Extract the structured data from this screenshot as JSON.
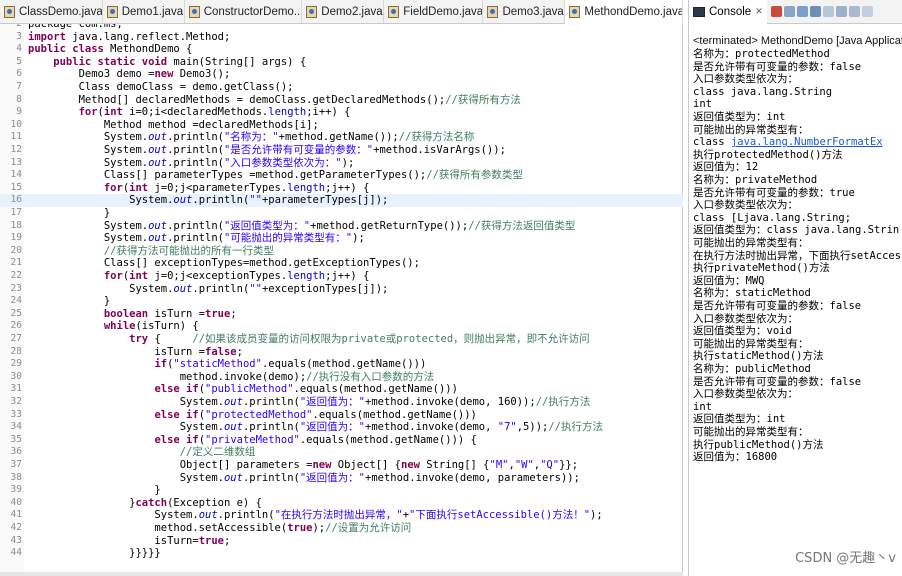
{
  "editor": {
    "tabs": [
      {
        "label": "ClassDemo.java",
        "active": false
      },
      {
        "label": "Demo1.java",
        "active": false
      },
      {
        "label": "ConstructorDemo...",
        "active": false
      },
      {
        "label": "Demo2.java",
        "active": false
      },
      {
        "label": "FieldDemo.java",
        "active": false
      },
      {
        "label": "Demo3.java",
        "active": false
      },
      {
        "label": "MethondDemo.java",
        "active": true
      }
    ],
    "lines": [
      {
        "n": "2",
        "segs": [
          {
            "t": "package com.ms;",
            "c": ""
          }
        ]
      },
      {
        "n": "3",
        "segs": [
          {
            "t": "import",
            "c": "kw"
          },
          {
            "t": " java.lang.reflect.Method;",
            "c": ""
          }
        ]
      },
      {
        "n": "4",
        "segs": [
          {
            "t": "public class",
            "c": "kw"
          },
          {
            "t": " MethondDemo {",
            "c": ""
          }
        ]
      },
      {
        "n": "5",
        "segs": [
          {
            "t": "    public static void",
            "c": "kw"
          },
          {
            "t": " main(String[] args) {",
            "c": ""
          }
        ]
      },
      {
        "n": "6",
        "segs": [
          {
            "t": "        Demo3 demo =",
            "c": ""
          },
          {
            "t": "new",
            "c": "kw"
          },
          {
            "t": " Demo3();",
            "c": ""
          }
        ]
      },
      {
        "n": "7",
        "segs": [
          {
            "t": "        Class demoClass = demo.getClass();",
            "c": ""
          }
        ]
      },
      {
        "n": "8",
        "segs": [
          {
            "t": "        Method[] declaredMethods = demoClass.getDeclaredMethods();",
            "c": ""
          },
          {
            "t": "//获得所有方法",
            "c": "cmt"
          }
        ]
      },
      {
        "n": "9",
        "segs": [
          {
            "t": "        ",
            "c": ""
          },
          {
            "t": "for",
            "c": "kw"
          },
          {
            "t": "(",
            "c": ""
          },
          {
            "t": "int",
            "c": "kw"
          },
          {
            "t": " i=0;i<declaredMethods.",
            "c": ""
          },
          {
            "t": "length",
            "c": "fld"
          },
          {
            "t": ";i++) {",
            "c": ""
          }
        ]
      },
      {
        "n": "10",
        "segs": [
          {
            "t": "            Method method =declaredMethods[i];",
            "c": ""
          }
        ]
      },
      {
        "n": "11",
        "segs": [
          {
            "t": "            System.",
            "c": ""
          },
          {
            "t": "out",
            "c": "fld ital"
          },
          {
            "t": ".println(",
            "c": ""
          },
          {
            "t": "\"名称为：\"",
            "c": "str"
          },
          {
            "t": "+method.getName());",
            "c": ""
          },
          {
            "t": "//获得方法名称",
            "c": "cmt"
          }
        ]
      },
      {
        "n": "12",
        "segs": [
          {
            "t": "            System.",
            "c": ""
          },
          {
            "t": "out",
            "c": "fld ital"
          },
          {
            "t": ".println(",
            "c": ""
          },
          {
            "t": "\"是否允许带有可变量的参数：\"",
            "c": "str"
          },
          {
            "t": "+method.isVarArgs());",
            "c": ""
          }
        ]
      },
      {
        "n": "13",
        "segs": [
          {
            "t": "            System.",
            "c": ""
          },
          {
            "t": "out",
            "c": "fld ital"
          },
          {
            "t": ".println(",
            "c": ""
          },
          {
            "t": "\"入口参数类型依次为：\"",
            "c": "str"
          },
          {
            "t": ");",
            "c": ""
          }
        ]
      },
      {
        "n": "14",
        "segs": [
          {
            "t": "            Class[] parameterTypes =method.getParameterTypes();",
            "c": ""
          },
          {
            "t": "//获得所有参数类型",
            "c": "cmt"
          }
        ]
      },
      {
        "n": "15",
        "segs": [
          {
            "t": "            ",
            "c": ""
          },
          {
            "t": "for",
            "c": "kw"
          },
          {
            "t": "(",
            "c": ""
          },
          {
            "t": "int",
            "c": "kw"
          },
          {
            "t": " j=0;j<parameterTypes.",
            "c": ""
          },
          {
            "t": "length",
            "c": "fld"
          },
          {
            "t": ";j++) {",
            "c": ""
          }
        ]
      },
      {
        "n": "16",
        "segs": [
          {
            "t": "                System.",
            "c": ""
          },
          {
            "t": "out",
            "c": "fld ital"
          },
          {
            "t": ".println(",
            "c": ""
          },
          {
            "t": "\"\"",
            "c": "str"
          },
          {
            "t": "+parameterTypes[j]);",
            "c": ""
          }
        ],
        "hl": true
      },
      {
        "n": "17",
        "segs": [
          {
            "t": "            }",
            "c": ""
          }
        ]
      },
      {
        "n": "18",
        "segs": [
          {
            "t": "            System.",
            "c": ""
          },
          {
            "t": "out",
            "c": "fld ital"
          },
          {
            "t": ".println(",
            "c": ""
          },
          {
            "t": "\"返回值类型为：\"",
            "c": "str"
          },
          {
            "t": "+method.getReturnType());",
            "c": ""
          },
          {
            "t": "//获得方法返回值类型",
            "c": "cmt"
          }
        ]
      },
      {
        "n": "19",
        "segs": [
          {
            "t": "            System.",
            "c": ""
          },
          {
            "t": "out",
            "c": "fld ital"
          },
          {
            "t": ".println(",
            "c": ""
          },
          {
            "t": "\"可能抛出的异常类型有：\"",
            "c": "str"
          },
          {
            "t": ");",
            "c": ""
          }
        ]
      },
      {
        "n": "20",
        "segs": [
          {
            "t": "            ",
            "c": ""
          },
          {
            "t": "//获得方法可能抛出的所有一行类型",
            "c": "cmt"
          }
        ]
      },
      {
        "n": "21",
        "segs": [
          {
            "t": "            Class[] exceptionTypes=method.getExceptionTypes();",
            "c": ""
          }
        ]
      },
      {
        "n": "22",
        "segs": [
          {
            "t": "            ",
            "c": ""
          },
          {
            "t": "for",
            "c": "kw"
          },
          {
            "t": "(",
            "c": ""
          },
          {
            "t": "int",
            "c": "kw"
          },
          {
            "t": " j=0;j<exceptionTypes.",
            "c": ""
          },
          {
            "t": "length",
            "c": "fld"
          },
          {
            "t": ";j++) {",
            "c": ""
          }
        ]
      },
      {
        "n": "23",
        "segs": [
          {
            "t": "                System.",
            "c": ""
          },
          {
            "t": "out",
            "c": "fld ital"
          },
          {
            "t": ".println(",
            "c": ""
          },
          {
            "t": "\"\"",
            "c": "str"
          },
          {
            "t": "+exceptionTypes[j]);",
            "c": ""
          }
        ]
      },
      {
        "n": "24",
        "segs": [
          {
            "t": "            }",
            "c": ""
          }
        ]
      },
      {
        "n": "25",
        "segs": [
          {
            "t": "            ",
            "c": ""
          },
          {
            "t": "boolean",
            "c": "kw"
          },
          {
            "t": " isTurn =",
            "c": ""
          },
          {
            "t": "true",
            "c": "kw"
          },
          {
            "t": ";",
            "c": ""
          }
        ]
      },
      {
        "n": "26",
        "segs": [
          {
            "t": "            ",
            "c": ""
          },
          {
            "t": "while",
            "c": "kw"
          },
          {
            "t": "(isTurn) {",
            "c": ""
          }
        ]
      },
      {
        "n": "27",
        "segs": [
          {
            "t": "                ",
            "c": ""
          },
          {
            "t": "try",
            "c": "kw"
          },
          {
            "t": " {     ",
            "c": ""
          },
          {
            "t": "//如果该成员变量的访问权限为private或protected，则抛出异常，即不允许访问",
            "c": "cmt"
          }
        ]
      },
      {
        "n": "28",
        "segs": [
          {
            "t": "                    isTurn =",
            "c": ""
          },
          {
            "t": "false",
            "c": "kw"
          },
          {
            "t": ";",
            "c": ""
          }
        ]
      },
      {
        "n": "29",
        "segs": [
          {
            "t": "                    ",
            "c": ""
          },
          {
            "t": "if",
            "c": "kw"
          },
          {
            "t": "(",
            "c": ""
          },
          {
            "t": "\"staticMethod\"",
            "c": "str"
          },
          {
            "t": ".equals(method.getName()))",
            "c": ""
          }
        ]
      },
      {
        "n": "30",
        "segs": [
          {
            "t": "                        method.invoke(demo);",
            "c": ""
          },
          {
            "t": "//执行没有入口参数的方法",
            "c": "cmt"
          }
        ]
      },
      {
        "n": "31",
        "segs": [
          {
            "t": "                    ",
            "c": ""
          },
          {
            "t": "else if",
            "c": "kw"
          },
          {
            "t": "(",
            "c": ""
          },
          {
            "t": "\"publicMethod\"",
            "c": "str"
          },
          {
            "t": ".equals(method.getName()))",
            "c": ""
          }
        ]
      },
      {
        "n": "32",
        "segs": [
          {
            "t": "                        System.",
            "c": ""
          },
          {
            "t": "out",
            "c": "fld ital"
          },
          {
            "t": ".println(",
            "c": ""
          },
          {
            "t": "\"返回值为：\"",
            "c": "str"
          },
          {
            "t": "+method.invoke(demo, 160));",
            "c": ""
          },
          {
            "t": "//执行方法",
            "c": "cmt"
          }
        ]
      },
      {
        "n": "33",
        "segs": [
          {
            "t": "                    ",
            "c": ""
          },
          {
            "t": "else if",
            "c": "kw"
          },
          {
            "t": "(",
            "c": ""
          },
          {
            "t": "\"protectedMethod\"",
            "c": "str"
          },
          {
            "t": ".equals(method.getName()))",
            "c": ""
          }
        ]
      },
      {
        "n": "34",
        "segs": [
          {
            "t": "                        System.",
            "c": ""
          },
          {
            "t": "out",
            "c": "fld ital"
          },
          {
            "t": ".println(",
            "c": ""
          },
          {
            "t": "\"返回值为：\"",
            "c": "str"
          },
          {
            "t": "+method.invoke(demo, ",
            "c": ""
          },
          {
            "t": "\"7\"",
            "c": "str"
          },
          {
            "t": ",5));",
            "c": ""
          },
          {
            "t": "//执行方法",
            "c": "cmt"
          }
        ]
      },
      {
        "n": "35",
        "segs": [
          {
            "t": "                    ",
            "c": ""
          },
          {
            "t": "else if",
            "c": "kw"
          },
          {
            "t": "(",
            "c": ""
          },
          {
            "t": "\"privateMethod\"",
            "c": "str"
          },
          {
            "t": ".equals(method.getName())) {",
            "c": ""
          }
        ]
      },
      {
        "n": "36",
        "segs": [
          {
            "t": "                        ",
            "c": ""
          },
          {
            "t": "//定义二维数组",
            "c": "cmt"
          }
        ]
      },
      {
        "n": "37",
        "segs": [
          {
            "t": "                        Object[] parameters =",
            "c": ""
          },
          {
            "t": "new",
            "c": "kw"
          },
          {
            "t": " Object[] {",
            "c": ""
          },
          {
            "t": "new",
            "c": "kw"
          },
          {
            "t": " String[] {",
            "c": ""
          },
          {
            "t": "\"M\"",
            "c": "str"
          },
          {
            "t": ",",
            "c": ""
          },
          {
            "t": "\"W\"",
            "c": "str"
          },
          {
            "t": ",",
            "c": ""
          },
          {
            "t": "\"Q\"",
            "c": "str"
          },
          {
            "t": "}};",
            "c": ""
          }
        ]
      },
      {
        "n": "38",
        "segs": [
          {
            "t": "                        System.",
            "c": ""
          },
          {
            "t": "out",
            "c": "fld ital"
          },
          {
            "t": ".println(",
            "c": ""
          },
          {
            "t": "\"返回值为：\"",
            "c": "str"
          },
          {
            "t": "+method.invoke(demo, parameters));",
            "c": ""
          }
        ]
      },
      {
        "n": "39",
        "segs": [
          {
            "t": "                    }",
            "c": ""
          }
        ]
      },
      {
        "n": "40",
        "segs": [
          {
            "t": "                }",
            "c": ""
          },
          {
            "t": "catch",
            "c": "kw"
          },
          {
            "t": "(Exception e) {",
            "c": ""
          }
        ]
      },
      {
        "n": "41",
        "segs": [
          {
            "t": "                    System.",
            "c": ""
          },
          {
            "t": "out",
            "c": "fld ital"
          },
          {
            "t": ".println(",
            "c": ""
          },
          {
            "t": "\"在执行方法时抛出异常，\"",
            "c": "str"
          },
          {
            "t": "+",
            "c": ""
          },
          {
            "t": "\"下面执行setAccessible()方法！\"",
            "c": "str"
          },
          {
            "t": ");",
            "c": ""
          }
        ]
      },
      {
        "n": "42",
        "segs": [
          {
            "t": "                    method.setAccessible(",
            "c": ""
          },
          {
            "t": "true",
            "c": "kw"
          },
          {
            "t": ");",
            "c": ""
          },
          {
            "t": "//设置为允许访问",
            "c": "cmt"
          }
        ]
      },
      {
        "n": "43",
        "segs": [
          {
            "t": "                    isTurn=",
            "c": ""
          },
          {
            "t": "true",
            "c": "kw"
          },
          {
            "t": ";",
            "c": ""
          }
        ]
      },
      {
        "n": "44",
        "segs": [
          {
            "t": "                }}}}}",
            "c": ""
          }
        ]
      }
    ]
  },
  "console": {
    "tab_label": "Console",
    "header": "<terminated> MethondDemo [Java Applicat",
    "lines": [
      {
        "t": "名称为：protectedMethod"
      },
      {
        "t": "是否允许带有可变量的参数：false"
      },
      {
        "t": "入口参数类型依次为："
      },
      {
        "t": "class java.lang.String"
      },
      {
        "t": "int"
      },
      {
        "t": "返回值类型为：int"
      },
      {
        "t": "可能抛出的异常类型有："
      },
      {
        "t": "class ",
        "link": "java.lang.NumberFormatEx"
      },
      {
        "t": "执行protectedMethod()方法"
      },
      {
        "t": "返回值为：12"
      },
      {
        "t": "名称为：privateMethod"
      },
      {
        "t": "是否允许带有可变量的参数：true"
      },
      {
        "t": "入口参数类型依次为："
      },
      {
        "t": "class [Ljava.lang.String;"
      },
      {
        "t": "返回值类型为：class java.lang.Strin"
      },
      {
        "t": "可能抛出的异常类型有："
      },
      {
        "t": "在执行方法时抛出异常，下面执行setAccessib"
      },
      {
        "t": "执行privateMethod()方法"
      },
      {
        "t": "返回值为：MWQ"
      },
      {
        "t": "名称为：staticMethod"
      },
      {
        "t": "是否允许带有可变量的参数：false"
      },
      {
        "t": "入口参数类型依次为："
      },
      {
        "t": "返回值类型为：void"
      },
      {
        "t": "可能抛出的异常类型有："
      },
      {
        "t": "执行staticMethod()方法"
      },
      {
        "t": "名称为：publicMethod"
      },
      {
        "t": "是否允许带有可变量的参数：false"
      },
      {
        "t": "入口参数类型依次为："
      },
      {
        "t": "int"
      },
      {
        "t": "返回值类型为：int"
      },
      {
        "t": "可能抛出的异常类型有："
      },
      {
        "t": "执行publicMethod()方法"
      },
      {
        "t": "返回值为：16800"
      }
    ],
    "watermark": "CSDN @无趣丶v"
  },
  "colors": {
    "keyword": "#7f0055",
    "string": "#2a00ff",
    "comment": "#3f7f5f",
    "field": "#0000c0",
    "highlight_line": "#e8f2fe",
    "link": "#1a5ad6"
  }
}
